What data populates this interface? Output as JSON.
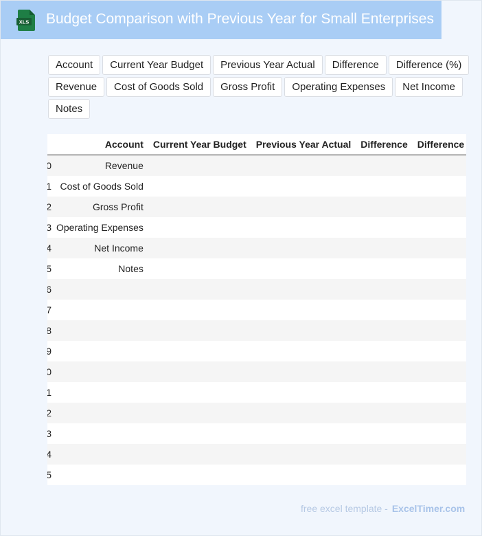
{
  "header": {
    "title": "Budget Comparison with Previous Year for Small Enterprises",
    "icon_label": "XLS",
    "icon_color": "#1e7e45",
    "bg_color": "#a9cdf5"
  },
  "chips": [
    "Account",
    "Current Year Budget",
    "Previous Year Actual",
    "Difference",
    "Difference (%)",
    "Revenue",
    "Cost of Goods Sold",
    "Gross Profit",
    "Operating Expenses",
    "Net Income",
    "Notes"
  ],
  "table": {
    "columns": [
      "Account",
      "Current Year Budget",
      "Previous Year Actual",
      "Difference",
      "Difference"
    ],
    "rows": [
      {
        "idx": "0",
        "account": "Revenue"
      },
      {
        "idx": "1",
        "account": "Cost of Goods Sold"
      },
      {
        "idx": "2",
        "account": "Gross Profit"
      },
      {
        "idx": "3",
        "account": "Operating Expenses"
      },
      {
        "idx": "4",
        "account": "Net Income"
      },
      {
        "idx": "5",
        "account": "Notes"
      },
      {
        "idx": "6",
        "account": ""
      },
      {
        "idx": "7",
        "account": ""
      },
      {
        "idx": "8",
        "account": ""
      },
      {
        "idx": "9",
        "account": ""
      },
      {
        "idx": "0",
        "account": ""
      },
      {
        "idx": "1",
        "account": ""
      },
      {
        "idx": "2",
        "account": ""
      },
      {
        "idx": "3",
        "account": ""
      },
      {
        "idx": "4",
        "account": ""
      },
      {
        "idx": "5",
        "account": ""
      }
    ]
  },
  "footer": {
    "text": "free excel template -",
    "brand": "ExcelTimer.com"
  }
}
